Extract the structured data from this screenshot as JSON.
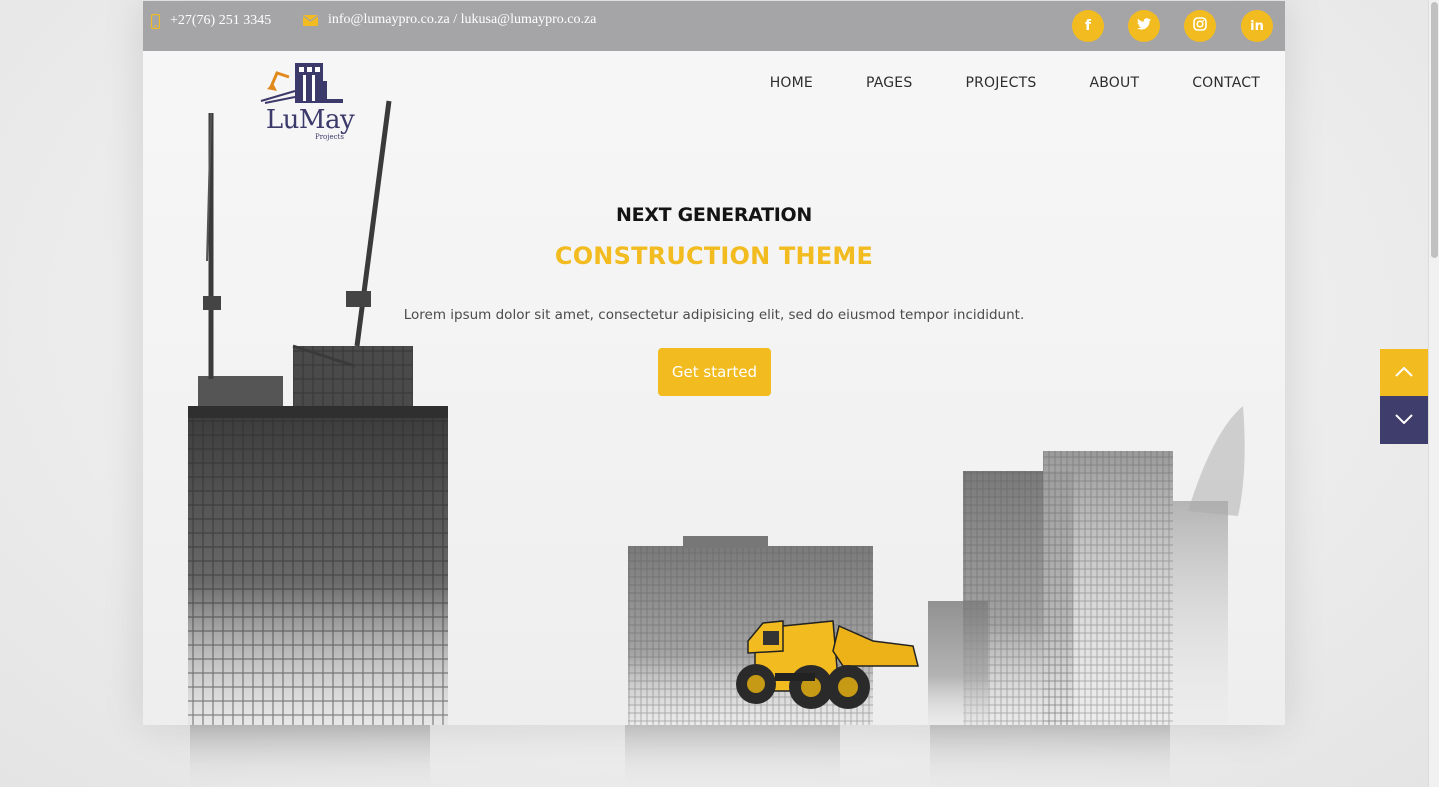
{
  "topbar": {
    "phone": "+27(76) 251 3345",
    "email": "info@lumaypro.co.za / lukusa@lumaypro.co.za",
    "social": [
      {
        "icon": "facebook-icon",
        "glyph": "f"
      },
      {
        "icon": "twitter-icon",
        "glyph": ""
      },
      {
        "icon": "instagram-icon",
        "glyph": ""
      },
      {
        "icon": "linkedin-icon",
        "glyph": "in"
      }
    ]
  },
  "logo": {
    "name": "LuMay",
    "tagline": "Projects"
  },
  "nav": {
    "items": [
      "HOME",
      "PAGES",
      "PROJECTS",
      "ABOUT",
      "CONTACT"
    ]
  },
  "hero": {
    "title": "NEXT GENERATION",
    "subtitle": "CONSTRUCTION THEME",
    "description": "Lorem ipsum dolor sit amet, consectetur adipisicing elit, sed do eiusmod tempor incididunt.",
    "cta_label": "Get started"
  },
  "scroll": {
    "up_icon": "chevron-up-icon",
    "down_icon": "chevron-down-icon"
  },
  "colors": {
    "accent": "#f2bb1f",
    "brand_dark": "#3f3d6b",
    "topbar": "#a5a5a7"
  }
}
